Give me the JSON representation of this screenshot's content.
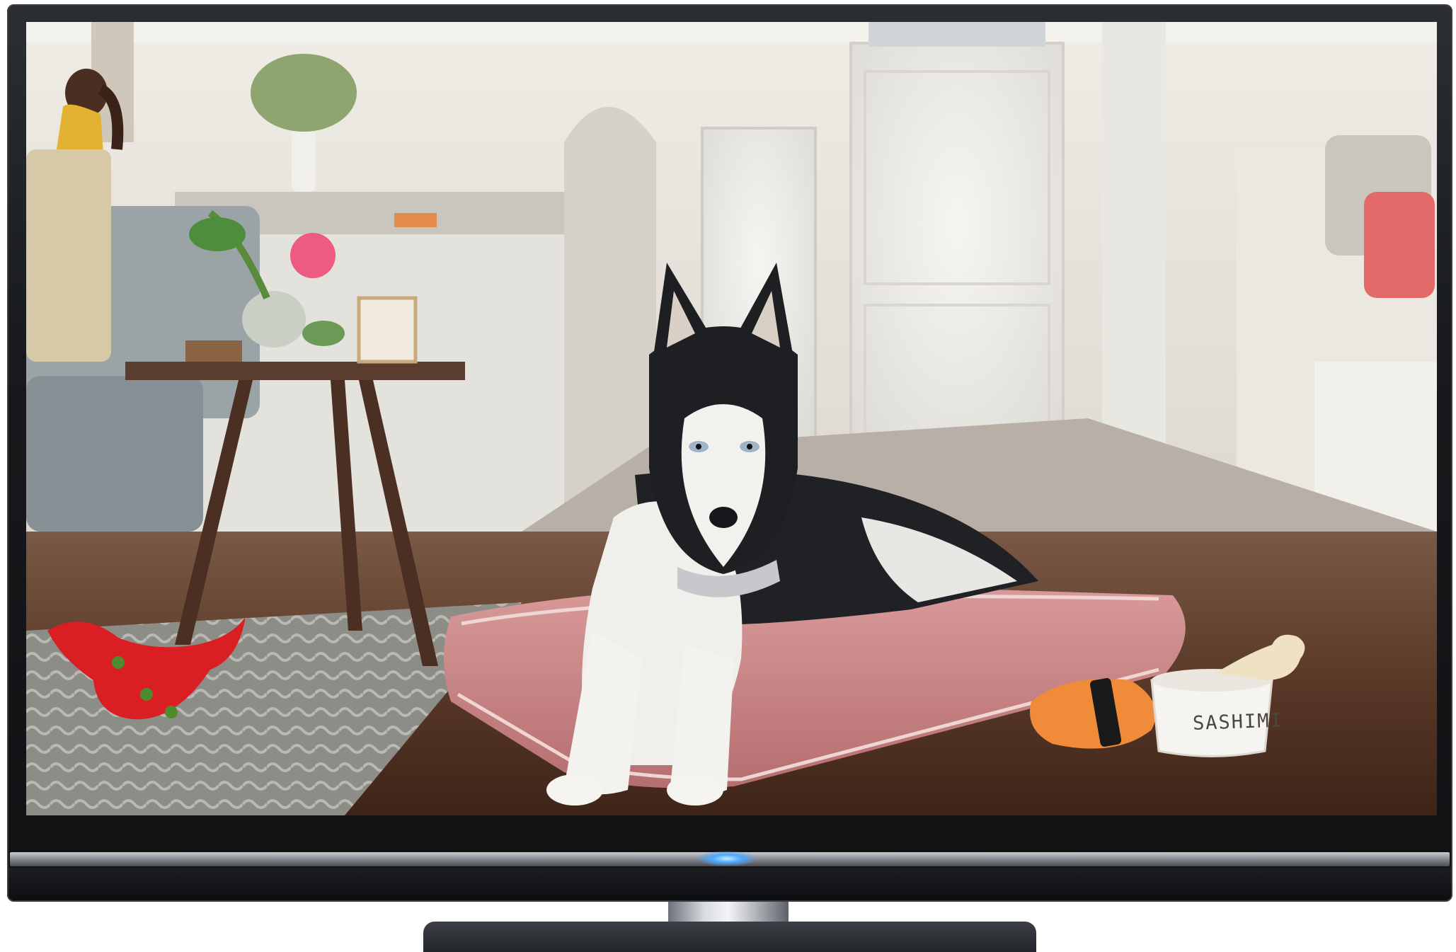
{
  "scene": {
    "bowl_label": "SASHIMI"
  },
  "colors": {
    "bezel": "#17191c",
    "power_led": "#4aa8ff",
    "dog_bed": "#c98383",
    "wall": "#e9e6df",
    "floor": "#5b3a29"
  },
  "icons": {
    "tv": "television-icon",
    "led": "power-led-icon"
  }
}
